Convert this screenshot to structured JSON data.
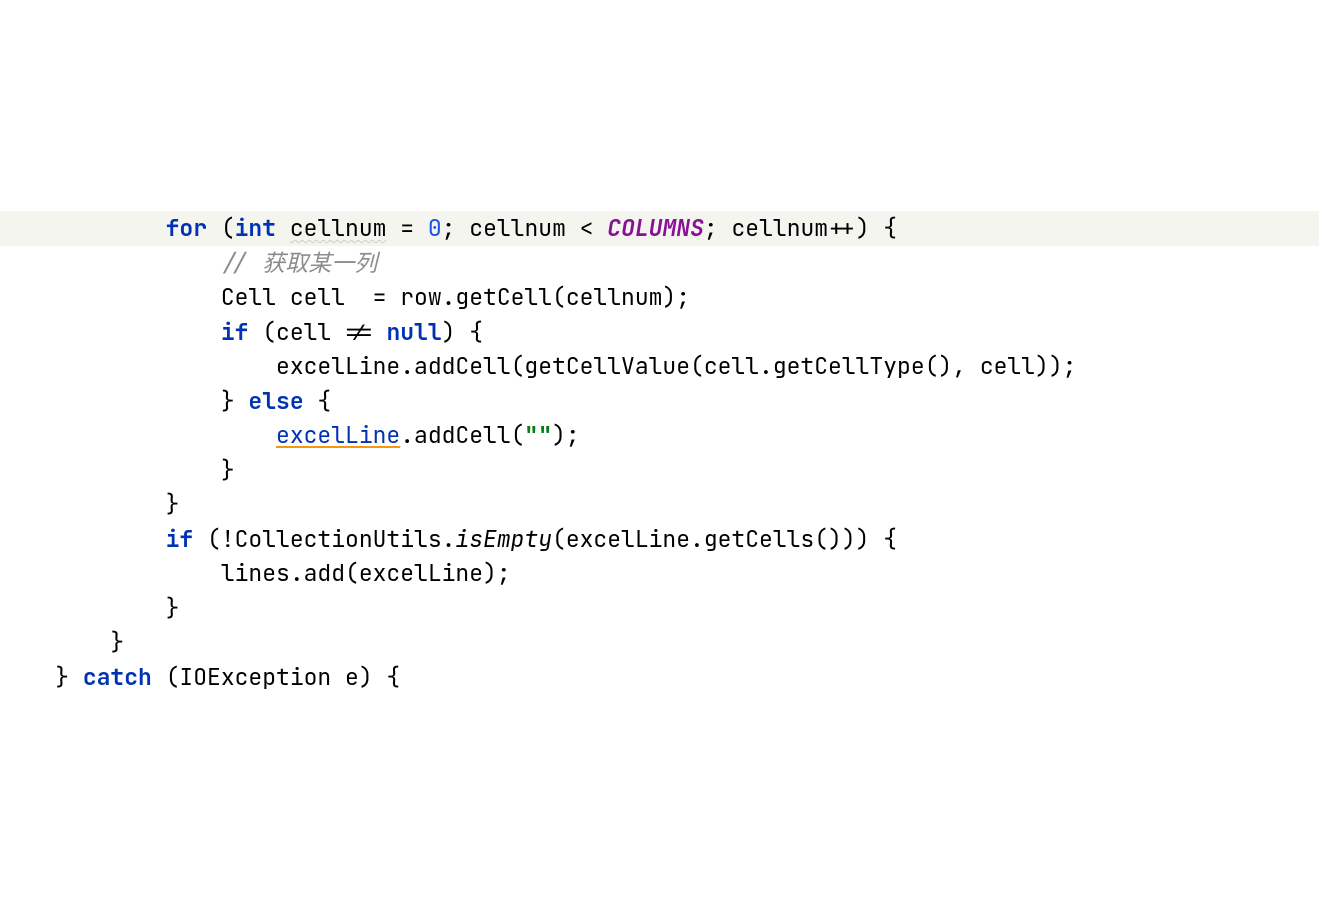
{
  "code": {
    "lines": [
      {
        "indent": "            ",
        "tokens": [
          {
            "t": "for",
            "c": "kw"
          },
          {
            "t": " (",
            "c": "plain"
          },
          {
            "t": "int",
            "c": "kw"
          },
          {
            "t": " ",
            "c": "plain"
          },
          {
            "t": "cellnum",
            "c": "var-hint"
          },
          {
            "t": " = ",
            "c": "plain"
          },
          {
            "t": "0",
            "c": "num"
          },
          {
            "t": "; cellnum < ",
            "c": "plain"
          },
          {
            "t": "COLUMNS",
            "c": "const"
          },
          {
            "t": "; cellnum++) {",
            "c": "plain"
          }
        ],
        "bg": true
      },
      {
        "indent": "                ",
        "tokens": [
          {
            "t": "// 获取某一列",
            "c": "comment"
          }
        ],
        "bg": false
      },
      {
        "indent": "                ",
        "tokens": [
          {
            "t": "Cell cell  = row.getCell(cellnum);",
            "c": "plain"
          }
        ],
        "bg": false
      },
      {
        "indent": "                ",
        "tokens": [
          {
            "t": "if",
            "c": "kw"
          },
          {
            "t": " (cell != ",
            "c": "plain"
          },
          {
            "t": "null",
            "c": "kw"
          },
          {
            "t": ") {",
            "c": "plain"
          }
        ],
        "bg": false
      },
      {
        "indent": "                    ",
        "tokens": [
          {
            "t": "excelLine.addCell(getCellValue(cell.getCellType(), cell));",
            "c": "plain"
          }
        ],
        "bg": false
      },
      {
        "indent": "                ",
        "tokens": [
          {
            "t": "} ",
            "c": "plain"
          },
          {
            "t": "else",
            "c": "kw"
          },
          {
            "t": " {",
            "c": "plain"
          }
        ],
        "bg": false
      },
      {
        "indent": "                    ",
        "tokens": [
          {
            "t": "excelLine",
            "c": "warn-link"
          },
          {
            "t": ".addCell(",
            "c": "plain"
          },
          {
            "t": "\"\"",
            "c": "str"
          },
          {
            "t": ");",
            "c": "plain"
          }
        ],
        "bg": false
      },
      {
        "indent": "                ",
        "tokens": [
          {
            "t": "}",
            "c": "plain"
          }
        ],
        "bg": false
      },
      {
        "indent": "            ",
        "tokens": [
          {
            "t": "}",
            "c": "plain"
          }
        ],
        "bg": false
      },
      {
        "indent": "            ",
        "tokens": [
          {
            "t": "if",
            "c": "kw"
          },
          {
            "t": " (!CollectionUtils.",
            "c": "plain"
          },
          {
            "t": "isEmpty",
            "c": "method-static"
          },
          {
            "t": "(excelLine.getCells())) {",
            "c": "plain"
          }
        ],
        "bg": false
      },
      {
        "indent": "                ",
        "tokens": [
          {
            "t": "lines.add(excelLine);",
            "c": "plain"
          }
        ],
        "bg": false
      },
      {
        "indent": "            ",
        "tokens": [
          {
            "t": "}",
            "c": "plain"
          }
        ],
        "bg": false
      },
      {
        "indent": "        ",
        "tokens": [
          {
            "t": "}",
            "c": "plain"
          }
        ],
        "bg": false
      },
      {
        "indent": "    ",
        "tokens": [
          {
            "t": "} ",
            "c": "plain"
          },
          {
            "t": "catch",
            "c": "kw"
          },
          {
            "t": " (IOException e) {",
            "c": "plain"
          }
        ],
        "bg": false
      }
    ]
  }
}
